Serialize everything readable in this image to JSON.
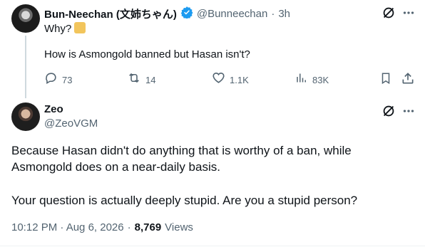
{
  "parent": {
    "name": "Bun-Neechan (文姉ちゃん)",
    "handle": "@Bunneechan",
    "separator": "·",
    "time": "3h",
    "line1": "Why?",
    "line2": "How is Asmongold banned but Hasan isn't?",
    "stats": {
      "replies": "73",
      "reposts": "14",
      "likes": "1.1K",
      "views": "83K"
    }
  },
  "reply": {
    "name": "Zeo",
    "handle": "@ZeoVGM",
    "paragraph1_line1": "Because Hasan didn't do anything that is worthy of a ban, while",
    "paragraph1_line2": "Asmongold does on a near-daily basis.",
    "paragraph2": "Your question is actually deeply stupid. Are you a stupid person?",
    "timestamp": "10:12 PM · Aug 6, 2026",
    "dot": "·",
    "views_count": "8,769",
    "views_label": "Views"
  },
  "colors": {
    "verified": "#1d9bf0",
    "muted": "#536471",
    "text": "#0f1419"
  },
  "icons": [
    "grok-icon",
    "more-icon",
    "verified-badge-icon",
    "reply-icon",
    "repost-icon",
    "like-icon",
    "views-icon",
    "bookmark-icon",
    "share-icon",
    "emoji-icon"
  ]
}
